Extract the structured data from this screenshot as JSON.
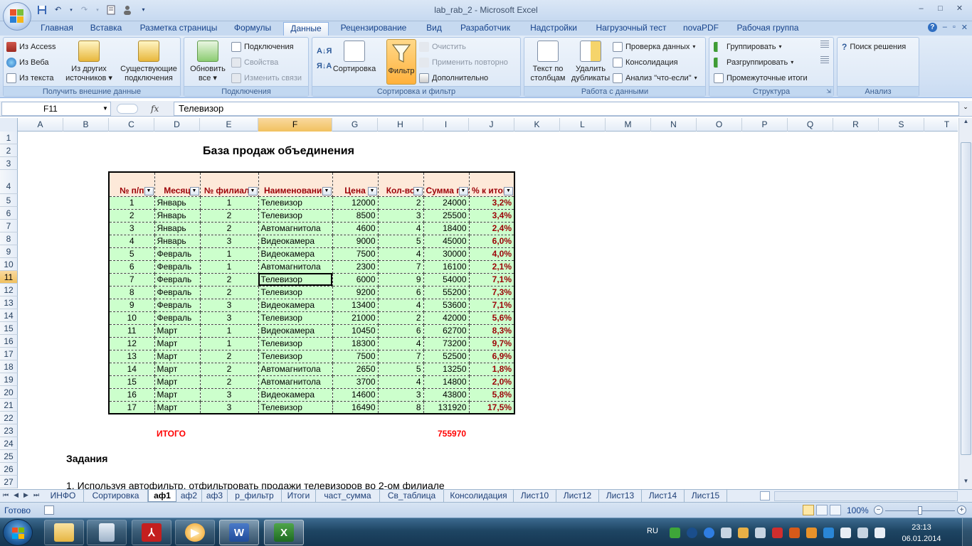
{
  "window": {
    "title": "lab_rab_2 - Microsoft Excel",
    "minimize": "–",
    "maximize": "□",
    "close": "✕"
  },
  "qat": [
    "save",
    "undo",
    "redo",
    "print-preview",
    "user"
  ],
  "ribbon_tabs": [
    "Главная",
    "Вставка",
    "Разметка страницы",
    "Формулы",
    "Данные",
    "Рецензирование",
    "Вид",
    "Разработчик",
    "Надстройки",
    "Нагрузочный тест",
    "novaPDF",
    "Рабочая группа"
  ],
  "active_ribbon_tab": "Данные",
  "ribbon": {
    "external": {
      "label": "Получить внешние данные",
      "from_access": "Из Access",
      "from_web": "Из Веба",
      "from_text": "Из текста",
      "from_other_1": "Из других",
      "from_other_2": "источников",
      "existing_1": "Существующие",
      "existing_2": "подключения"
    },
    "connections": {
      "label": "Подключения",
      "refresh_1": "Обновить",
      "refresh_2": "все",
      "connections": "Подключения",
      "properties": "Свойства",
      "edit_links": "Изменить связи"
    },
    "sort_filter": {
      "label": "Сортировка и фильтр",
      "sort": "Сортировка",
      "filter": "Фильтр",
      "clear": "Очистить",
      "reapply": "Применить повторно",
      "advanced": "Дополнительно"
    },
    "data_tools": {
      "label": "Работа с данными",
      "text_to_cols_1": "Текст по",
      "text_to_cols_2": "столбцам",
      "remove_dup_1": "Удалить",
      "remove_dup_2": "дубликаты",
      "validation": "Проверка данных",
      "consolidate": "Консолидация",
      "whatif": "Анализ \"что-если\""
    },
    "outline": {
      "label": "Структура",
      "group": "Группировать",
      "ungroup": "Разгруппировать",
      "subtotal": "Промежуточные итоги"
    },
    "analysis": {
      "label": "Анализ",
      "solver": "Поиск решения"
    }
  },
  "formula_bar": {
    "name_box": "F11",
    "fx": "fx",
    "value": "Телевизор"
  },
  "columns": [
    "A",
    "B",
    "C",
    "D",
    "E",
    "F",
    "G",
    "H",
    "I",
    "J",
    "K",
    "L",
    "M",
    "N",
    "O",
    "P",
    "Q",
    "R",
    "S",
    "T"
  ],
  "rows": [
    "1",
    "2",
    "3",
    "4",
    "5",
    "6",
    "7",
    "8",
    "9",
    "10",
    "11",
    "12",
    "13",
    "14",
    "15",
    "16",
    "17",
    "18",
    "19",
    "20",
    "21",
    "22",
    "23",
    "24",
    "25",
    "26",
    "27"
  ],
  "selected_cell": {
    "column": "F",
    "row": "11"
  },
  "sheet_title": "База продаж объединения",
  "table": {
    "headers": [
      "№ п/п",
      "Месяц",
      "№ филиала",
      "Наименование",
      "Цена",
      "Кол-во",
      "Сумма продаж",
      "% к итогу"
    ],
    "rows": [
      [
        "1",
        "Январь",
        "1",
        "Телевизор",
        "12000",
        "2",
        "24000",
        "3,2%"
      ],
      [
        "2",
        "Январь",
        "2",
        "Телевизор",
        "8500",
        "3",
        "25500",
        "3,4%"
      ],
      [
        "3",
        "Январь",
        "2",
        "Автомагнитола",
        "4600",
        "4",
        "18400",
        "2,4%"
      ],
      [
        "4",
        "Январь",
        "3",
        "Видеокамера",
        "9000",
        "5",
        "45000",
        "6,0%"
      ],
      [
        "5",
        "Февраль",
        "1",
        "Видеокамера",
        "7500",
        "4",
        "30000",
        "4,0%"
      ],
      [
        "6",
        "Февраль",
        "1",
        "Автомагнитола",
        "2300",
        "7",
        "16100",
        "2,1%"
      ],
      [
        "7",
        "Февраль",
        "2",
        "Телевизор",
        "6000",
        "9",
        "54000",
        "7,1%"
      ],
      [
        "8",
        "Февраль",
        "2",
        "Телевизор",
        "9200",
        "6",
        "55200",
        "7,3%"
      ],
      [
        "9",
        "Февраль",
        "3",
        "Видеокамера",
        "13400",
        "4",
        "53600",
        "7,1%"
      ],
      [
        "10",
        "Февраль",
        "3",
        "Телевизор",
        "21000",
        "2",
        "42000",
        "5,6%"
      ],
      [
        "11",
        "Март",
        "1",
        "Видеокамера",
        "10450",
        "6",
        "62700",
        "8,3%"
      ],
      [
        "12",
        "Март",
        "1",
        "Телевизор",
        "18300",
        "4",
        "73200",
        "9,7%"
      ],
      [
        "13",
        "Март",
        "2",
        "Телевизор",
        "7500",
        "7",
        "52500",
        "6,9%"
      ],
      [
        "14",
        "Март",
        "2",
        "Автомагнитола",
        "2650",
        "5",
        "13250",
        "1,8%"
      ],
      [
        "15",
        "Март",
        "2",
        "Автомагнитола",
        "3700",
        "4",
        "14800",
        "2,0%"
      ],
      [
        "16",
        "Март",
        "3",
        "Видеокамера",
        "14600",
        "3",
        "43800",
        "5,8%"
      ],
      [
        "17",
        "Март",
        "3",
        "Телевизор",
        "16490",
        "8",
        "131920",
        "17,5%"
      ]
    ]
  },
  "totals": {
    "label": "ИТОГО",
    "sum": "755970"
  },
  "tasks": {
    "heading": "Задания",
    "item1": "1. Используя автофильтр, отфильтровать продажи телевизоров во 2-ом филиале"
  },
  "sheet_tabs": [
    "ИНФО",
    "Сортировка",
    "аф1",
    "аф2",
    "аф3",
    "р_фильтр",
    "Итоги",
    "част_сумма",
    "Св_таблица",
    "Консолидация",
    "Лист10",
    "Лист12",
    "Лист13",
    "Лист14",
    "Лист15"
  ],
  "active_sheet": "аф1",
  "status": {
    "ready": "Готово",
    "zoom": "100%"
  },
  "taskbar": {
    "apps": [
      "explorer",
      "calculator",
      "adobe-reader",
      "media-player",
      "word",
      "excel"
    ],
    "lang": "RU",
    "time": "23:13",
    "date": "06.01.2014"
  },
  "colors": {
    "header_fill": "#fde9d9",
    "header_text": "#9c0006",
    "body_fill": "#ccffcc",
    "totals_text": "#ff0000",
    "ribbon_tab_text": "#15428b"
  }
}
